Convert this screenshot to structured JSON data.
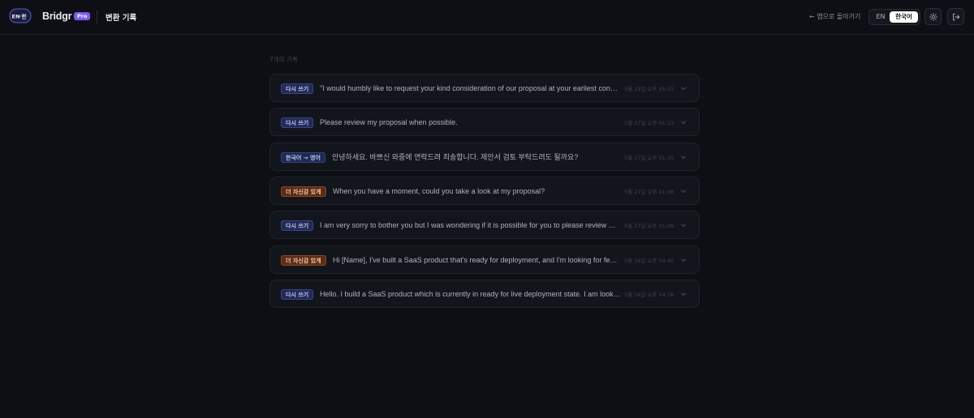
{
  "header": {
    "logo_text_left": "EN",
    "logo_text_right": "한",
    "brand": "Bridgr",
    "pro_badge": "Pro",
    "title": "변환 기록",
    "back_link": "← 앱으로 돌아가기",
    "lang_en": "EN",
    "lang_ko": "한국어",
    "theme_icon": "sun-icon",
    "logout_icon": "logout-icon"
  },
  "main": {
    "count_label": "7개의 기록",
    "items": [
      {
        "tag": "다시 쓰기",
        "tag_type": "rewrite",
        "text": "\"I would humbly like to request your kind consideration of our proposal at your earliest convenience.\"",
        "time": "5월 29일 오후 05:15"
      },
      {
        "tag": "다시 쓰기",
        "tag_type": "rewrite",
        "text": "Please review my proposal when possible.",
        "time": "5월 27일 오후 01:13"
      },
      {
        "tag": "한국어 → 영어",
        "tag_type": "translate",
        "text": "안녕하세요. 바쁘신 와중에 연락드려 죄송합니다. 제안서 검토 부탁드려도 될까요?",
        "time": "5월 27일 오후 01:10"
      },
      {
        "tag": "더 자신감 있게",
        "tag_type": "confident",
        "text": "When you have a moment, could you take a look at my proposal?",
        "time": "5월 27일 오후 01:08"
      },
      {
        "tag": "다시 쓰기",
        "tag_type": "rewrite",
        "text": "I am very sorry to bother you but I was wondering if it is possible for you to please review my proposal",
        "time": "5월 27일 오후 01:08"
      },
      {
        "tag": "더 자신감 있게",
        "tag_type": "confident",
        "text": "Hi [Name], I've built a SaaS product that's ready for deployment, and I'm looking for feedback",
        "time": "5월 26일 오후 04:40"
      },
      {
        "tag": "다시 쓰기",
        "tag_type": "rewrite",
        "text": "Hello. I build a SaaS product which is currently in ready for live deployment state. I am looking for",
        "time": "5월 26일 오후 04:38"
      }
    ]
  },
  "colors": {
    "background": "#0d0f14",
    "accent": "#7c5cf0",
    "rewrite_tag": "#232a55",
    "confident_tag": "#5a2d17"
  }
}
